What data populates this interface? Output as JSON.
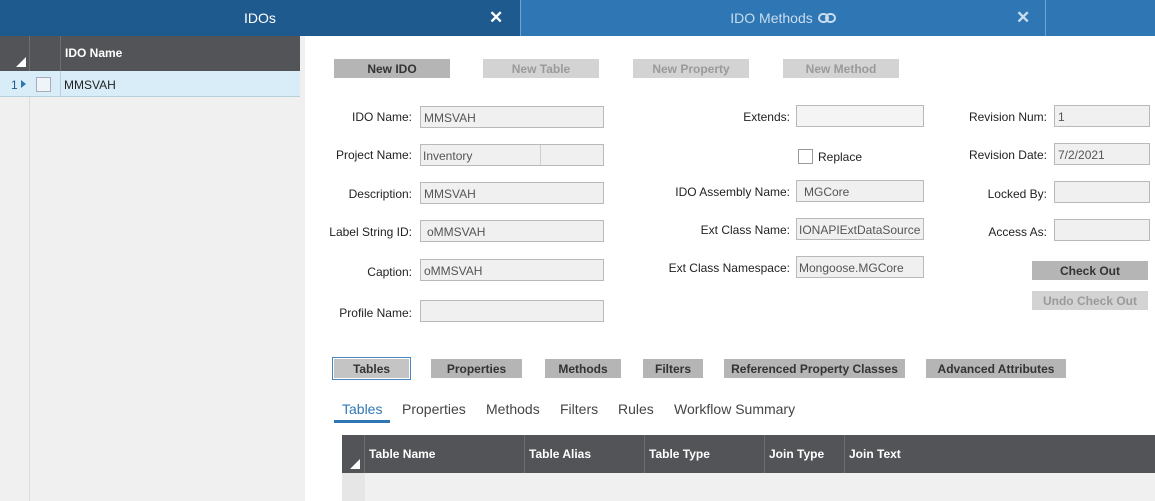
{
  "tabs": [
    {
      "label": "IDOs"
    },
    {
      "label": "IDO Methods"
    }
  ],
  "list_grid": {
    "column_header": "IDO Name",
    "rows": [
      {
        "num": "1",
        "ido_name": "MMSVAH"
      }
    ]
  },
  "toolbar": {
    "new_ido": "New IDO",
    "new_table": "New Table",
    "new_property": "New Property",
    "new_method": "New Method"
  },
  "form": {
    "ido_name_label": "IDO Name:",
    "ido_name_value": "MMSVAH",
    "project_name_label": "Project Name:",
    "project_name_value": "Inventory",
    "description_label": "Description:",
    "description_value": "MMSVAH",
    "label_string_id_label": "Label String ID:",
    "label_string_id_value": "oMMSVAH",
    "caption_label": "Caption:",
    "caption_value": "oMMSVAH",
    "profile_name_label": "Profile Name:",
    "profile_name_value": "",
    "extends_label": "Extends:",
    "extends_value": "",
    "replace_label": "Replace",
    "ido_assembly_name_label": "IDO Assembly Name:",
    "ido_assembly_name_value": "MGCore",
    "ext_class_name_label": "Ext Class Name:",
    "ext_class_name_value": "IONAPIExtDataSource",
    "ext_class_namespace_label": "Ext Class Namespace:",
    "ext_class_namespace_value": "Mongoose.MGCore",
    "revision_num_label": "Revision Num:",
    "revision_num_value": "1",
    "revision_date_label": "Revision Date:",
    "revision_date_value": "7/2/2021",
    "locked_by_label": "Locked By:",
    "locked_by_value": "",
    "access_as_label": "Access As:",
    "access_as_value": "",
    "check_out": "Check Out",
    "undo_check_out": "Undo Check Out"
  },
  "section_buttons": {
    "tables": "Tables",
    "properties": "Properties",
    "methods": "Methods",
    "filters": "Filters",
    "referenced_property_classes": "Referenced Property Classes",
    "advanced_attributes": "Advanced Attributes"
  },
  "sub_tabs": {
    "tables": "Tables",
    "properties": "Properties",
    "methods": "Methods",
    "filters": "Filters",
    "rules": "Rules",
    "workflow_summary": "Workflow Summary"
  },
  "tables_grid": {
    "columns": [
      "Table Name",
      "Table Alias",
      "Table Type",
      "Join Type",
      "Join Text"
    ]
  },
  "colors": {
    "tab_active": "#1f5a8f",
    "tab_bar": "#2f76b4",
    "grid_header": "#535458",
    "selected_row": "#d9edf8"
  }
}
